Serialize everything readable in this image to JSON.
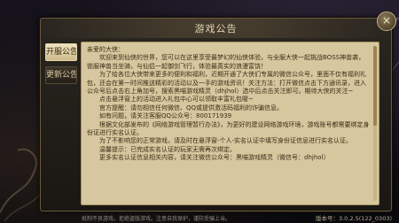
{
  "dialog": {
    "title": "游戏公告",
    "close_label": "×"
  },
  "tabs": [
    {
      "label": "开服公告"
    },
    {
      "label": "更新公告"
    }
  ],
  "notice": {
    "greeting": "亲爱的大侠：",
    "p1": "欢迎来到仙侠的世界，您可以在这里享受最梦幻的仙侠体验，与全服大侠一起挑战BOSS神兽袭，锁服神兽当坐骑，与仙侣一起御剑飞行，体验最真实的浪漫富饶！",
    "p2": "为了给各位大侠带来更多的便利和福利，近期开通了大侠们专属的微信公众号，里面不仅有福利礼包，还会在第一时间推送精彩的活动以及一手的游戏资讯！关注方法：打开微信点击下方通讯录，进入公众号后点击右上角加号，搜索黑喵游戏精灵（dhjhol）选中后点击关注即可。期待大侠的关注~",
    "p3": "点击悬浮窗上的活动进入礼包中心可以领取丰富礼包喔~",
    "p4": "官方提醒：请勿相信任何微信、QQ或提供激活码福利的诈骗信息。",
    "p5": "如有问题，请关注客服QQ公众号：800171939",
    "p6": "根据文化部发布的《网络游戏管理暂行办法》，为更好的建设网络游戏环境，游戏账号都需要绑定身份证进行实名认证。",
    "p7": "为了不影响您的正常游戏，请及时在悬浮窗-个人-实名认证中填写身份证信息进行实名认证。",
    "p8": "温馨提示：已完成实名认证的玩家无需再次绑定。",
    "p9": "更多实名认证信息相关内容，请关注微信公众号：黑喵游戏精灵（微信号：dhjhol）"
  },
  "footer": {
    "left_text": "抵制不良游戏，拒绝盗版游戏。注意自我保护，谨防受骗上当。",
    "version": "版本号：3.0.2.5(122_0303)"
  }
}
